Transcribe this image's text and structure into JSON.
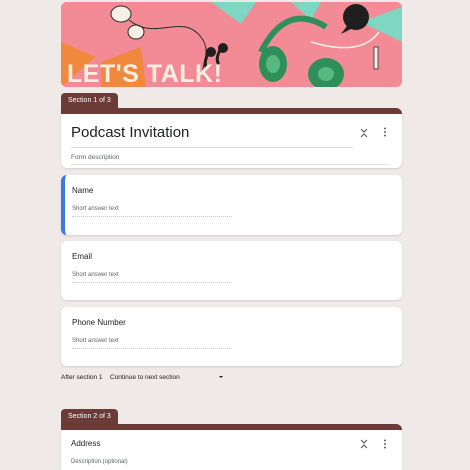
{
  "banner": {
    "text": "LET'S TALK!"
  },
  "sections": [
    {
      "label": "Section 1 of 3"
    },
    {
      "label": "Section 2 of 3"
    }
  ],
  "form": {
    "title": "Podcast Invitation",
    "description_placeholder": "Form description"
  },
  "questions": [
    {
      "title": "Name",
      "placeholder": "Short answer text"
    },
    {
      "title": "Email",
      "placeholder": "Short answer text"
    },
    {
      "title": "Phone Number",
      "placeholder": "Short answer text"
    }
  ],
  "after_section": {
    "label": "After section 1",
    "value": "Continue to next section"
  },
  "section2": {
    "title": "Address",
    "description_placeholder": "Description (optional)"
  },
  "icons": {
    "collapse": "collapse-icon",
    "more": "more-vert-icon",
    "dropdown": "caret-down-icon"
  },
  "colors": {
    "accent": "#6b3b38",
    "active_border": "#3b78e7",
    "background": "#efe9e8",
    "banner_bg": "#f28b96"
  }
}
